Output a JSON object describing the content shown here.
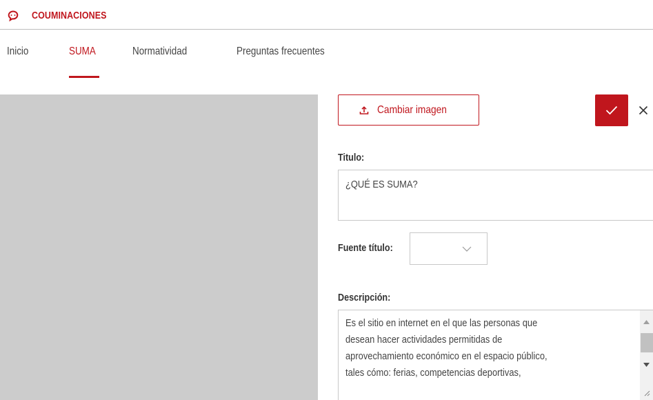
{
  "header": {
    "app_title": "COUMINACIONES",
    "logo_icon": "chat-bubble-icon",
    "accent_color": "#c0161d"
  },
  "tabs": [
    {
      "label": "Inicio",
      "active": false
    },
    {
      "label": "SUMA",
      "active": true
    },
    {
      "label": "Normatividad",
      "active": false
    },
    {
      "label": "Preguntas frecuentes",
      "active": false
    }
  ],
  "editor": {
    "change_image_label": "Cambiar imagen",
    "change_image_icon": "upload-icon",
    "confirm_icon": "check-icon",
    "cancel_icon": "close-icon",
    "title_label": "Titulo:",
    "title_value": "¿QUÉ ES SUMA?",
    "font_label": "Fuente título:",
    "font_value": "",
    "description_label": "Descripción:",
    "description_lines": [
      "Es el sitio en internet en el que las personas que",
      "desean hacer actividades permitidas de",
      "aprovechamiento económico en el espacio público,",
      "tales cómo: ferias, competencias deportivas,"
    ]
  }
}
